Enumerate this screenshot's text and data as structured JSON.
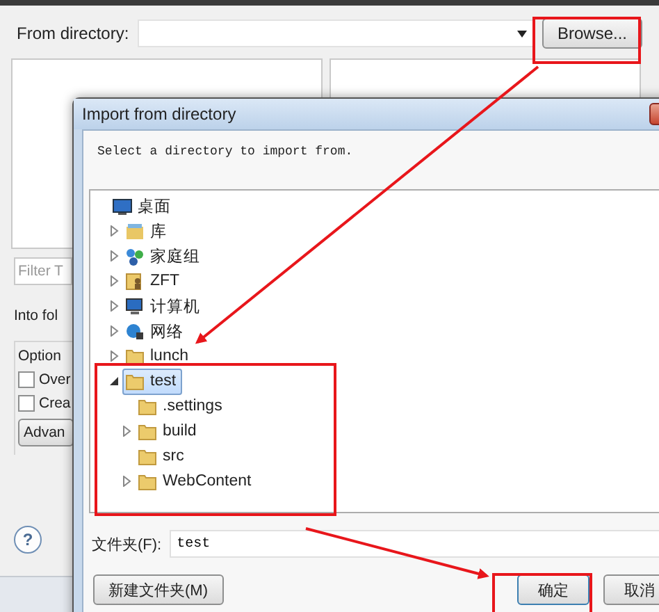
{
  "window": {
    "directory_label": "From directory:",
    "browse_button": "Browse...",
    "filter_placeholder": "Filter T",
    "into_folder_label": "Into fol",
    "options_group": "Option",
    "options": [
      {
        "label": "Over",
        "checked": false
      },
      {
        "label": "Crea",
        "checked": false
      }
    ],
    "advanced_button": "Advan",
    "help_icon": "?"
  },
  "dialog": {
    "title": "Import from directory",
    "message": "Select a directory to import from.",
    "tree": [
      {
        "label": "桌面",
        "kind": "desktop",
        "selected": false,
        "children": [
          {
            "label": "库",
            "kind": "library",
            "selected": false,
            "expanded": false
          },
          {
            "label": "家庭组",
            "kind": "homegroup",
            "selected": false,
            "expanded": false
          },
          {
            "label": "ZFT",
            "kind": "user",
            "selected": false,
            "expanded": false
          },
          {
            "label": "计算机",
            "kind": "computer",
            "selected": false,
            "expanded": false
          },
          {
            "label": "网络",
            "kind": "network",
            "selected": false,
            "expanded": false
          },
          {
            "label": "lunch",
            "kind": "folder",
            "selected": false,
            "expanded": false
          },
          {
            "label": "test",
            "kind": "folder",
            "selected": true,
            "expanded": true,
            "children": [
              {
                "label": ".settings",
                "kind": "folder",
                "selected": false
              },
              {
                "label": "build",
                "kind": "folder",
                "selected": false,
                "expanded": false
              },
              {
                "label": "src",
                "kind": "folder",
                "selected": false
              },
              {
                "label": "WebContent",
                "kind": "folder",
                "selected": false,
                "expanded": false
              }
            ]
          }
        ]
      }
    ],
    "folder_label": "文件夹(F):",
    "folder_value": "test",
    "buttons": [
      {
        "label": "新建文件夹(M)",
        "kind": "secondary"
      },
      {
        "label": "确定",
        "kind": "default"
      },
      {
        "label": "取消",
        "kind": "secondary"
      }
    ]
  }
}
